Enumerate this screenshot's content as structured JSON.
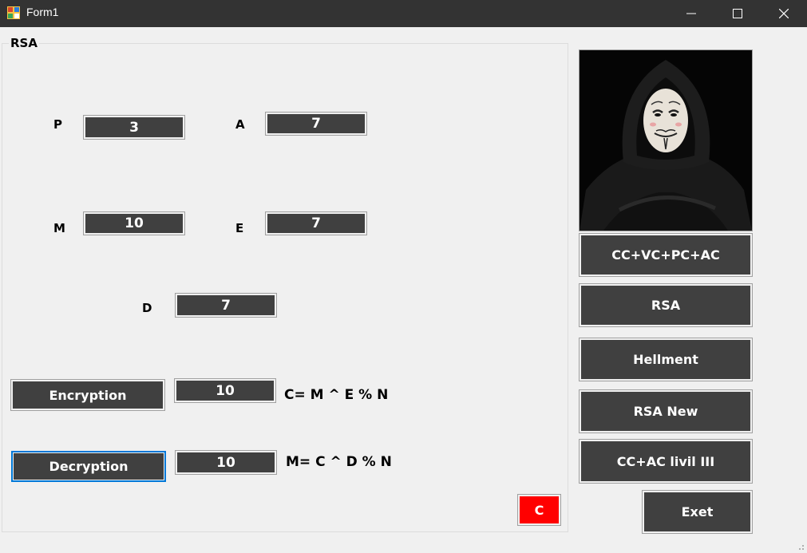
{
  "window": {
    "title": "Form1"
  },
  "rsa_group": {
    "legend": "RSA",
    "fields": {
      "p": {
        "label": "P",
        "value": "3"
      },
      "a": {
        "label": "A",
        "value": "7"
      },
      "m": {
        "label": "M",
        "value": "10"
      },
      "e": {
        "label": "E",
        "value": "7"
      },
      "d": {
        "label": "D",
        "value": "7"
      }
    },
    "encryption": {
      "button": "Encryption",
      "result": "10",
      "formula": "C= M ^ E % N"
    },
    "decryption": {
      "button": "Decryption",
      "result": "10",
      "formula": "M= C ^ D % N"
    },
    "clear_button": "C"
  },
  "side_menu": {
    "buttons": [
      "CC+VC+PC+AC",
      "RSA",
      "Hellment",
      "RSA New",
      "CC+AC livil III"
    ],
    "exit": "Exet"
  },
  "colors": {
    "titlebar": "#333333",
    "button_fill": "#404040",
    "clear_button": "#ff0000",
    "focus_border": "#0078d7"
  }
}
